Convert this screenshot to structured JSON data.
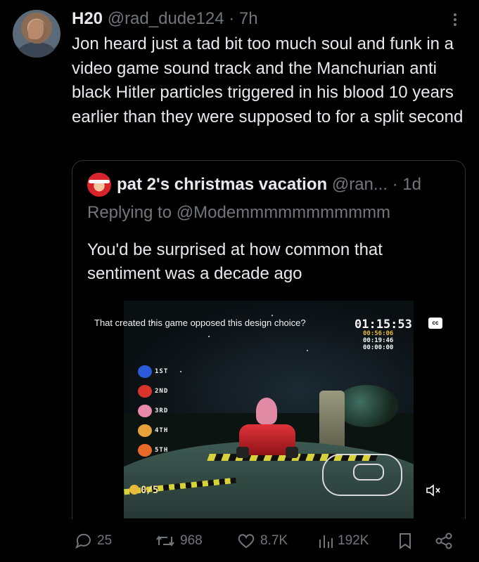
{
  "tweet": {
    "display_name": "H20",
    "handle": "@rad_dude124",
    "separator": "·",
    "time": "7h",
    "text": "Jon heard just a tad bit too much soul and funk in a video game sound track and the Manchurian anti black Hitler particles triggered in his blood 10 years earlier than they were supposed to for a split second"
  },
  "quote": {
    "display_name": "pat 2's christmas vacation",
    "handle": "@ran...",
    "separator": "·",
    "time": "1d",
    "replying_to": "Replying to @Modemmmmmmmmmmm",
    "text": "You'd be surprised at how common that sentiment was a decade ago",
    "video": {
      "caption": "That created this game opposed this design choice?",
      "cc_label": "cc",
      "race_time": "01:15:53",
      "lap_times": [
        "00:56:06",
        "00:19:46",
        "00:00:00"
      ],
      "ranks": [
        "1ST",
        "2ND",
        "3RD",
        "4TH",
        "5TH"
      ],
      "ring_counter": "0/5"
    }
  },
  "actions": {
    "replies": "25",
    "retweets": "968",
    "likes": "8.7K",
    "views": "192K"
  }
}
